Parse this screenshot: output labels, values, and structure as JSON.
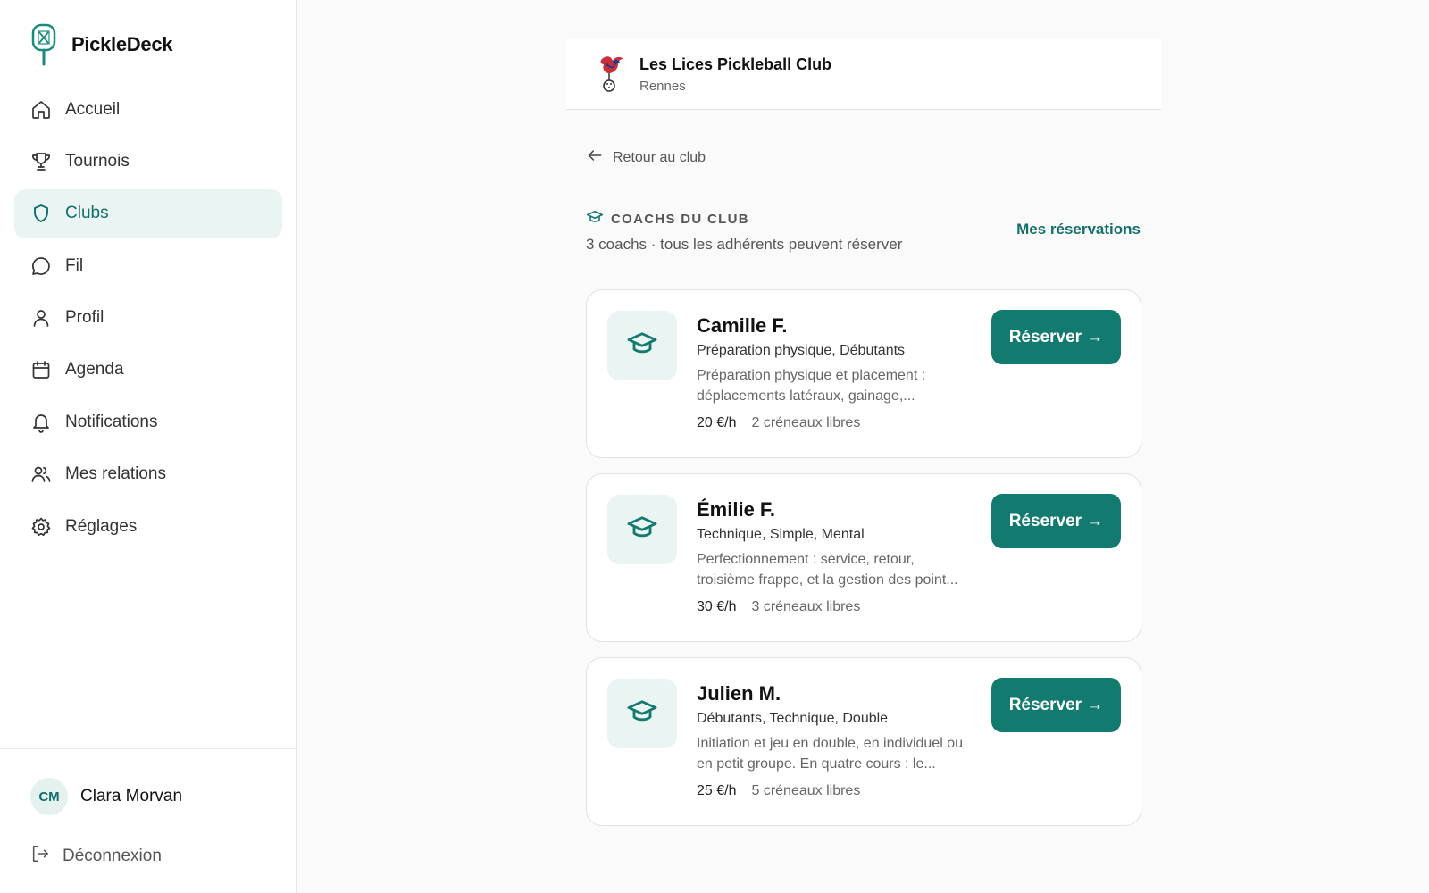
{
  "app": {
    "name": "PickleDeck"
  },
  "sidebar": {
    "items": [
      {
        "label": "Accueil",
        "icon": "home-icon"
      },
      {
        "label": "Tournois",
        "icon": "trophy-icon"
      },
      {
        "label": "Clubs",
        "icon": "shield-icon",
        "active": true
      },
      {
        "label": "Fil",
        "icon": "chat-bubble-icon"
      },
      {
        "label": "Profil",
        "icon": "user-icon"
      },
      {
        "label": "Agenda",
        "icon": "calendar-icon"
      },
      {
        "label": "Notifications",
        "icon": "bell-icon"
      },
      {
        "label": "Mes relations",
        "icon": "users-icon"
      },
      {
        "label": "Réglages",
        "icon": "gear-icon"
      }
    ]
  },
  "user": {
    "initials": "CM",
    "name": "Clara Morvan"
  },
  "logout_label": "Déconnexion",
  "club": {
    "name": "Les Lices Pickleball Club",
    "city": "Rennes"
  },
  "back_label": "Retour au club",
  "section": {
    "title": "COACHS DU CLUB",
    "subtitle": "3 coachs · tous les adhérents peuvent réserver",
    "my_bookings_label": "Mes réservations"
  },
  "coaches": [
    {
      "name": "Camille F.",
      "tags": "Préparation physique, Débutants",
      "desc_line1": "Préparation physique et placement :",
      "desc_line2": "déplacements latéraux, gainage,...",
      "price": "20 €/h",
      "slots": "2 créneaux libres",
      "button_label": "Réserver →"
    },
    {
      "name": "Émilie F.",
      "tags": "Technique, Simple, Mental",
      "desc_line1": "Perfectionnement : service, retour,",
      "desc_line2": "troisième frappe, et la gestion des point...",
      "price": "30 €/h",
      "slots": "3 créneaux libres",
      "button_label": "Réserver →"
    },
    {
      "name": "Julien M.",
      "tags": "Débutants, Technique, Double",
      "desc_line1": "Initiation et jeu en double, en individuel ou",
      "desc_line2": "en petit groupe. En quatre cours : le...",
      "price": "25 €/h",
      "slots": "5 créneaux libres",
      "button_label": "Réserver →"
    }
  ],
  "colors": {
    "accent": "#127a6e",
    "accent_light": "#eaf4f2",
    "background": "#fafafa"
  }
}
